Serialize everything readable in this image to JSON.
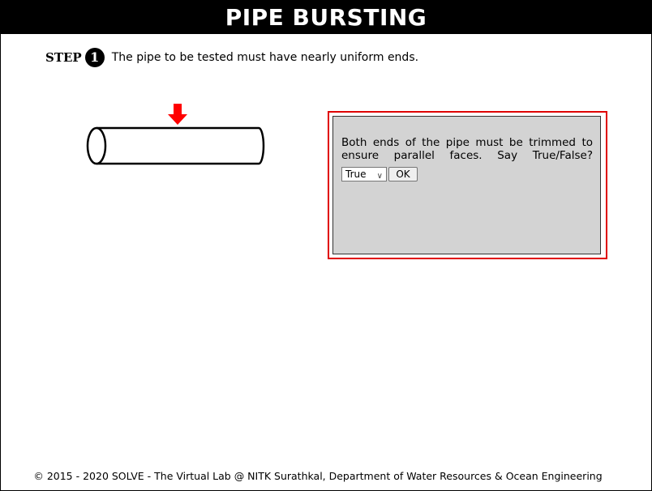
{
  "header": {
    "title": "PIPE BURSTING"
  },
  "step": {
    "label": "STEP",
    "number": "1",
    "instruction": "The pipe to be tested must have nearly uniform ends."
  },
  "diagram": {
    "arrow_color": "#ff0000",
    "icons": [
      "red-down-arrow-icon",
      "pipe-cylinder-icon"
    ]
  },
  "quiz": {
    "question_line1": "Both ends of the pipe must be trimmed to",
    "question_line2": "ensure parallel faces. Say True/False?",
    "select_value": "True",
    "ok_label": "OK",
    "border_color": "#e00000",
    "panel_color": "#d3d3d3"
  },
  "footer": {
    "text": "© 2015 - 2020 SOLVE - The Virtual Lab @ NITK Surathkal, Department of Water Resources & Ocean Engineering"
  }
}
